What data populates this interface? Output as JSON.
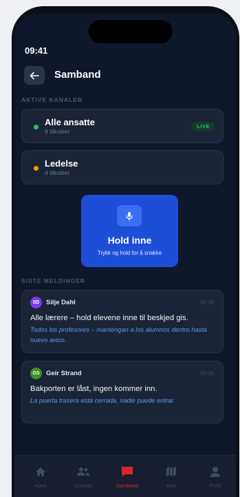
{
  "status": {
    "time": "09:41"
  },
  "header": {
    "title": "Samband",
    "back_icon": "arrow-left-icon"
  },
  "channels_section": {
    "label": "AKTIVE KANALER",
    "items": [
      {
        "name": "Alle ansatte",
        "count": "9 tilkoblet",
        "dot_color": "#22c55e",
        "badge": "LIVE"
      },
      {
        "name": "Ledelse",
        "count": "4 tilkoblet",
        "dot_color": "#f59e0b"
      }
    ]
  },
  "ptt": {
    "icon": "microphone-icon",
    "title": "Hold inne",
    "subtitle": "Trykk og hold for å snakke"
  },
  "messages_section": {
    "label": "SISTE MELDINGER",
    "items": [
      {
        "initials": "SD",
        "avatar_color": "#7c3aed",
        "sender": "Silje Dahl",
        "time": "09:38",
        "text": "Alle lærere – hold elevene inne til beskjed gis.",
        "translation": "Todos los profesores – mantengan a los alumnos dentro hasta nuevo aviso."
      },
      {
        "initials": "GS",
        "avatar_color": "#3f8f1f",
        "sender": "Geir Strand",
        "time": "09:39",
        "text": "Bakporten er låst, ingen kommer inn.",
        "translation": "La puerta trasera está cerrada, nadie puede entrar."
      }
    ]
  },
  "tabbar": {
    "active_color": "#dc2626",
    "tabs": [
      {
        "label": "Hjem",
        "icon": "home-icon"
      },
      {
        "label": "Oversikt",
        "icon": "users-icon"
      },
      {
        "label": "Samband",
        "icon": "chat-icon",
        "active": true
      },
      {
        "label": "Kart",
        "icon": "map-icon"
      },
      {
        "label": "Profil",
        "icon": "profile-icon"
      }
    ]
  }
}
